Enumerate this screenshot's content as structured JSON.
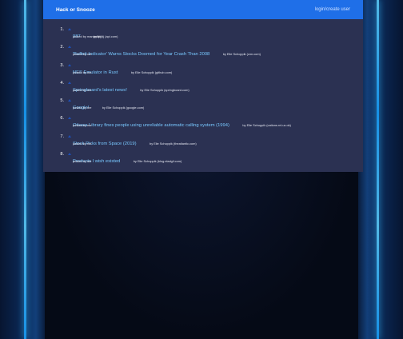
{
  "header": {
    "brand": "Hack or Snooze",
    "login": "login/create user"
  },
  "stories": [
    {
      "rank": "1.",
      "title": "987",
      "meta": "by tjtjtjtj (api.com)",
      "posted": "posted by mangofan"
    },
    {
      "rank": "2.",
      "title": "'Buffett Indicator' Warns Stocks Doomed for Year Crash Than 2008",
      "meta": "by Elie Schoppik (cnn.com)",
      "posted": "posted by me"
    },
    {
      "rank": "3.",
      "title": "NES Emulator in Rust",
      "meta": "by Elie Schoppik (github.com)",
      "posted": "posted by me"
    },
    {
      "rank": "4.",
      "title": "Springboard's latest news!",
      "meta": "by Elie Schoppik (springboard.com)",
      "posted": "posted by me"
    },
    {
      "rank": "5.",
      "title": "Google!",
      "meta": "by Elie Schoppik (google.com)",
      "posted": "posted by me"
    },
    {
      "rank": "6.",
      "title": "Ottawa Library fines people using unreliable automatic calling system (1994)",
      "meta": "by Elie Schoppik (cations.rnl.uc.ok)",
      "posted": "posted by me"
    },
    {
      "rank": "7.",
      "title": "Stock Picks from Space (2019)",
      "meta": "by Elie Schoppik (theatlantic.com)",
      "posted": "posted by me"
    },
    {
      "rank": "8.",
      "title": "Products I wish existed",
      "meta": "by Elie Schoppik (blog.eladgil.com)",
      "posted": "posted by me"
    }
  ]
}
